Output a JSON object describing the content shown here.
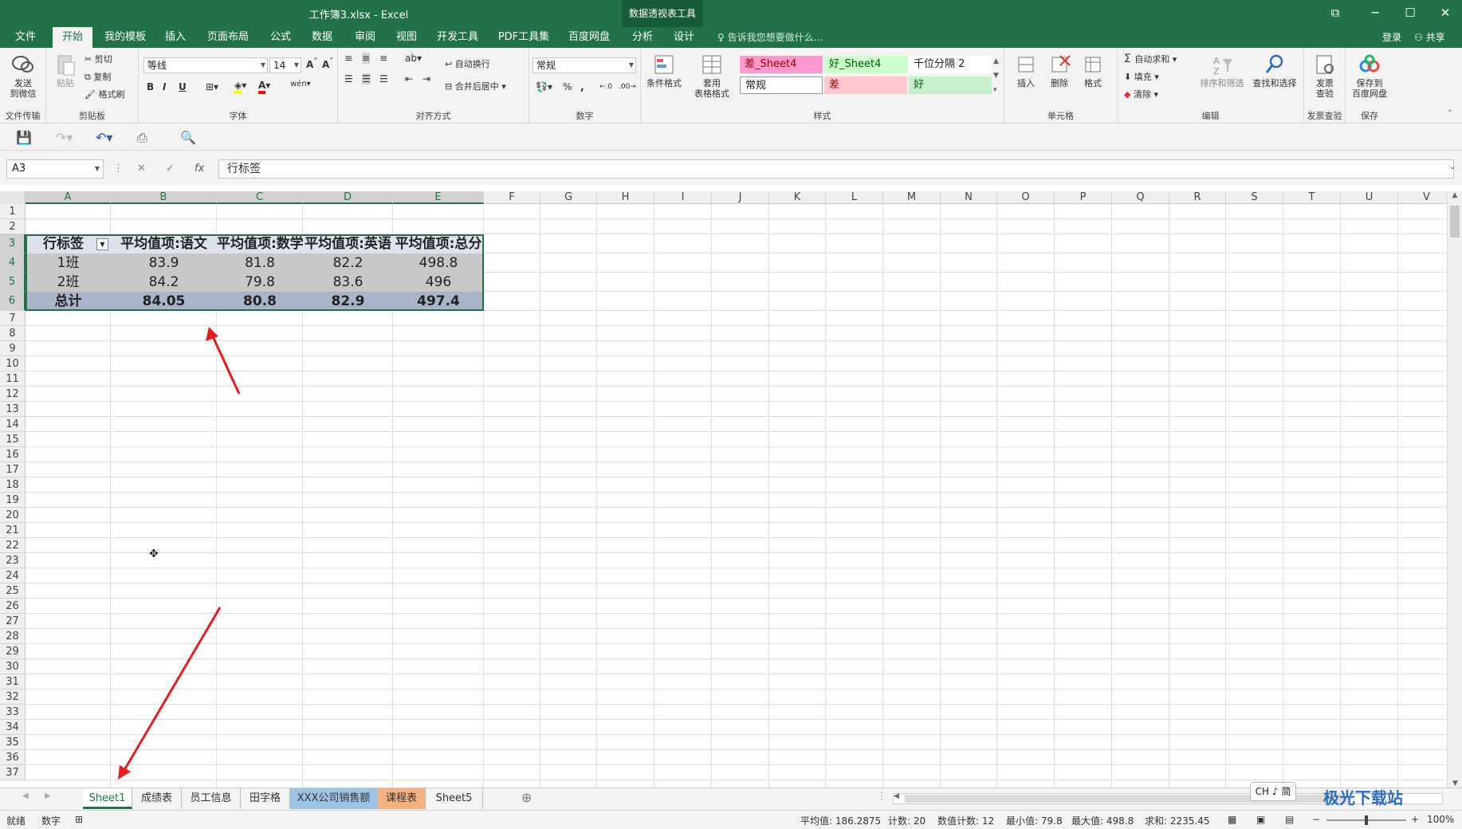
{
  "window": {
    "title": "工作簿3.xlsx - Excel",
    "context_tab_group": "数据透视表工具"
  },
  "tabs": [
    "文件",
    "开始",
    "我的模板",
    "插入",
    "页面布局",
    "公式",
    "数据",
    "审阅",
    "视图",
    "开发工具",
    "PDF工具集",
    "百度网盘",
    "分析",
    "设计"
  ],
  "tell_me": "告诉我您想要做什么...",
  "account": {
    "login": "登录",
    "share": "共享"
  },
  "ribbon": {
    "send_wechat": "发送\n到微信",
    "file_transfer": "文件传输",
    "paste": "粘贴",
    "cut": "剪切",
    "copy": "复制",
    "format_painter": "格式刷",
    "clipboard": "剪贴板",
    "font_name": "等线",
    "font_size": "14",
    "bold": "B",
    "italic": "I",
    "underline": "U",
    "font_group": "字体",
    "wrap_text": "自动换行",
    "merge_center": "合并后居中",
    "align_group": "对齐方式",
    "number_format": "常规",
    "percent": "%",
    "comma": ",",
    "number_group": "数字",
    "cond_format": "条件格式",
    "table_format": "套用\n表格格式",
    "styles": {
      "s1": "差_Sheet4",
      "s2": "好_Sheet4",
      "s3": "千位分隔 2",
      "s4": "常规",
      "s5": "差",
      "s6": "好"
    },
    "style_group": "样式",
    "insert": "插入",
    "delete": "删除",
    "format": "格式",
    "cells_group": "单元格",
    "autosum": "自动求和",
    "fill": "填充",
    "clear": "清除",
    "sort_filter": "排序和筛选",
    "find_select": "查找和选择",
    "edit_group": "编辑",
    "invoice": "发票\n查验",
    "invoice_group": "发票查验",
    "save_baidu": "保存到\n百度网盘",
    "save_group": "保存"
  },
  "formula_bar": {
    "name_box": "A3",
    "formula": "行标签"
  },
  "columns": [
    "A",
    "B",
    "C",
    "D",
    "E",
    "F",
    "G",
    "H",
    "I",
    "J",
    "K",
    "L",
    "M",
    "N",
    "O",
    "P",
    "Q",
    "R",
    "S",
    "T",
    "U",
    "V"
  ],
  "rows": [
    "1",
    "2",
    "3",
    "4",
    "5",
    "6",
    "7",
    "8",
    "9",
    "10",
    "11",
    "12",
    "13",
    "14",
    "15",
    "16",
    "17",
    "18",
    "19",
    "20",
    "21",
    "22",
    "23",
    "24",
    "25",
    "26",
    "27",
    "28",
    "29",
    "30",
    "31",
    "32",
    "33",
    "34",
    "35",
    "36",
    "37"
  ],
  "pivot": {
    "headers": [
      "行标签",
      "平均值项:语文",
      "平均值项:数学",
      "平均值项:英语",
      "平均值项:总分"
    ],
    "rows": [
      [
        "1班",
        "83.9",
        "81.8",
        "82.2",
        "498.8"
      ],
      [
        "2班",
        "84.2",
        "79.8",
        "83.6",
        "496"
      ]
    ],
    "total": [
      "总计",
      "84.05",
      "80.8",
      "82.9",
      "497.4"
    ]
  },
  "sheets": [
    "Sheet1",
    "成绩表",
    "员工信息",
    "田字格",
    "XXX公司销售额",
    "课程表",
    "Sheet5"
  ],
  "sheet_colors": {
    "XXX公司销售额": "#9dc3e6",
    "课程表": "#f4b183"
  },
  "status": {
    "ready": "就绪",
    "mode": "数字",
    "average": "平均值: 186.2875",
    "count": "计数: 20",
    "numeric_count": "数值计数: 12",
    "min": "最小值: 79.8",
    "max": "最大值: 498.8",
    "sum": "求和: 2235.45",
    "zoom": "100%"
  },
  "ime": "CH ♪ 简",
  "watermark": "极光下载站"
}
